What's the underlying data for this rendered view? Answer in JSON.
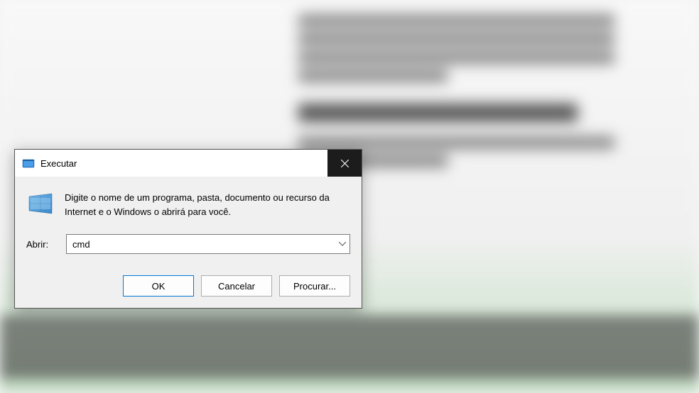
{
  "dialog": {
    "title": "Executar",
    "description": "Digite o nome de um programa, pasta, documento ou recurso da Internet e o Windows o abrirá para você.",
    "input_label": "Abrir:",
    "input_value": "cmd",
    "buttons": {
      "ok": "OK",
      "cancel": "Cancelar",
      "browse": "Procurar..."
    },
    "icons": {
      "titlebar": "run-dialog-icon",
      "body": "run-program-icon",
      "close": "close-icon",
      "dropdown": "chevron-down-icon"
    }
  }
}
